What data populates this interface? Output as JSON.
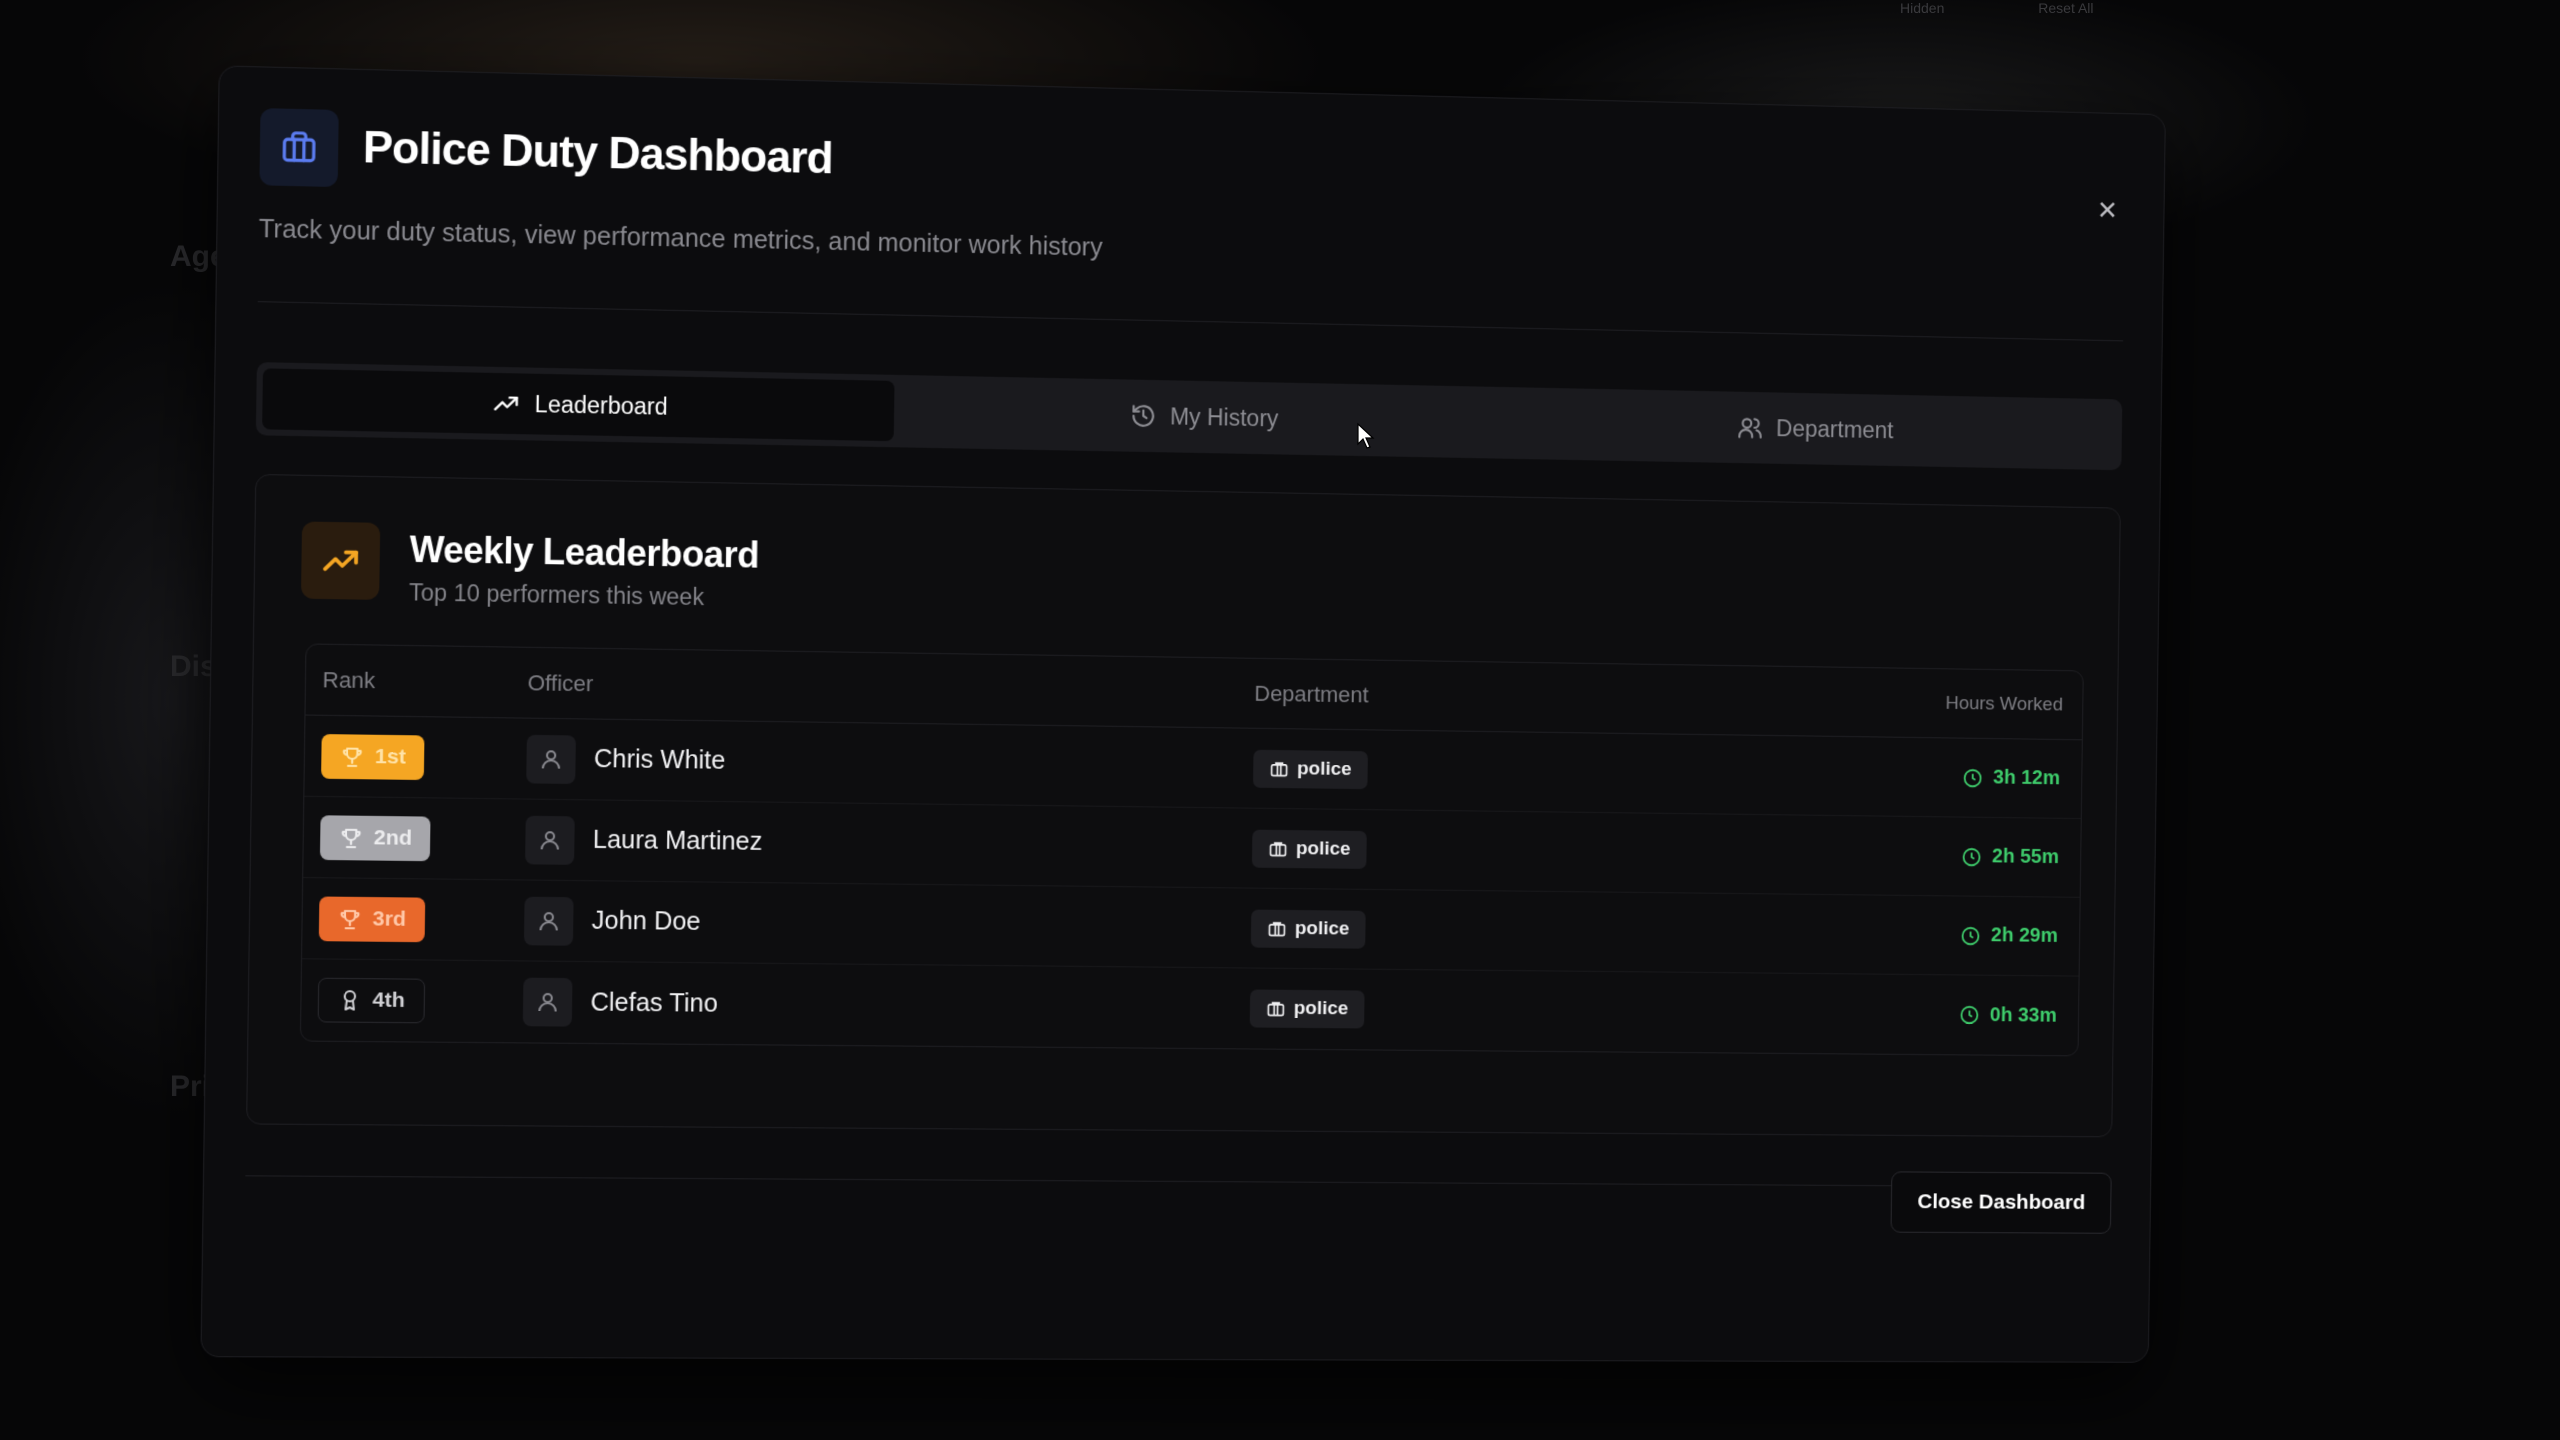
{
  "backdrop": {
    "top_hints": [
      "Hidden",
      "Reset All"
    ],
    "side_labels": [
      "Age",
      "Dis",
      "Pri"
    ]
  },
  "dashboard": {
    "title": "Police Duty Dashboard",
    "subtitle": "Track your duty status, view performance metrics, and monitor work history",
    "close_icon": "close-icon",
    "header_icon": "briefcase-icon"
  },
  "tabs": [
    {
      "label": "Leaderboard",
      "icon": "trending-up-icon",
      "active": true
    },
    {
      "label": "My History",
      "icon": "history-icon",
      "active": false
    },
    {
      "label": "Department",
      "icon": "users-icon",
      "active": false
    }
  ],
  "leaderboard": {
    "title": "Weekly Leaderboard",
    "subtitle": "Top 10 performers this week",
    "columns": {
      "rank": "Rank",
      "officer": "Officer",
      "department": "Department",
      "hours": "Hours Worked"
    },
    "rows": [
      {
        "rank": "1st",
        "officer": "Chris White",
        "department": "police",
        "hours": "3h 12m"
      },
      {
        "rank": "2nd",
        "officer": "Laura Martinez",
        "department": "police",
        "hours": "2h 55m"
      },
      {
        "rank": "3rd",
        "officer": "John Doe",
        "department": "police",
        "hours": "2h 29m"
      },
      {
        "rank": "4th",
        "officer": "Clefas Tino",
        "department": "police",
        "hours": "0h 33m"
      }
    ]
  },
  "footer": {
    "close_label": "Close Dashboard"
  },
  "colors": {
    "gold": "#f5a623",
    "silver": "#a6a6ab",
    "bronze": "#e8682b",
    "hours_green": "#3ecb6b",
    "accent_orange": "#f5a623"
  }
}
